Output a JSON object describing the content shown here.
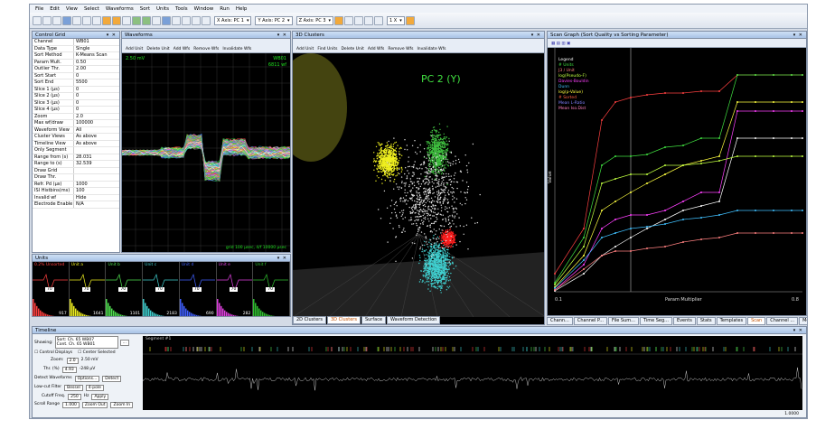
{
  "menu": [
    "File",
    "Edit",
    "View",
    "Select",
    "Waveforms",
    "Sort",
    "Units",
    "Tools",
    "Window",
    "Run",
    "Help"
  ],
  "toolbar": {
    "axis_x": "X Axis: PC 1",
    "axis_y": "Y Axis: PC 2",
    "axis_z": "Z Axis: PC 3",
    "zoom": "1 X"
  },
  "control_grid": {
    "title": "Control Grid",
    "rows": [
      [
        "Channel",
        "WB01"
      ],
      [
        "Data Type",
        "Single"
      ],
      [
        "Sort Method",
        "K-Means Scan"
      ],
      [
        "Param Mult.",
        "0.50"
      ],
      [
        "Outlier Thr.",
        "2.00"
      ],
      [
        "Sort Start",
        "0"
      ],
      [
        "Sort End",
        "5500"
      ],
      [
        "Slice 1 (µs)",
        "0"
      ],
      [
        "Slice 2 (µs)",
        "0"
      ],
      [
        "Slice 3 (µs)",
        "0"
      ],
      [
        "Slice 4 (µs)",
        "0"
      ],
      [
        "Zoom",
        "2.0"
      ],
      [
        "Max wf/draw",
        "100000"
      ],
      [
        "Waveform View",
        "All"
      ],
      [
        "Cluster Views",
        "As above"
      ],
      [
        "Timeline View",
        "As above"
      ],
      [
        "Only Segment",
        ""
      ],
      [
        "Range from (s)",
        "28.031"
      ],
      [
        "Range to (s)",
        "32.539"
      ],
      [
        "Draw Grid",
        ""
      ],
      [
        "Draw Thr.",
        ""
      ],
      [
        "Refr. Pd (µs)",
        "1000"
      ],
      [
        "ISI Histbins(ms)",
        "100"
      ],
      [
        "Invalid wf",
        "Hide"
      ],
      [
        "Electrode Enable",
        "N/A"
      ]
    ]
  },
  "waveforms": {
    "title": "Waveforms",
    "scale": "2.50 mV",
    "ch": "WB01",
    "count": "6811 wf",
    "footer": "grid 100 µsec, 4/f 10000 µsec",
    "toolbar": [
      "Add Unit",
      "Delete Unit",
      "Add Wfs",
      "Remove Wfs",
      "Invalidate Wfs"
    ]
  },
  "clusters": {
    "title": "3D Clusters",
    "axis_label": "PC 2 (Y)",
    "toolbar": [
      "Add Unit",
      "Find Units",
      "Delete Unit",
      "Add Wfs",
      "Remove Wfs",
      "Invalidate Wfs"
    ],
    "tabs": [
      "2D Clusters",
      "3D Clusters",
      "Surface",
      "Waveform Detection"
    ],
    "active_tab": "3D Clusters"
  },
  "scan": {
    "title": "Scan Graph (Sort Quality vs Sorting Parameter)",
    "legend": [
      "Legend",
      "# Units",
      "J3 / Unit",
      "log(Pseudo-F)",
      "Davies-Bouldin",
      "Dunn",
      "log(p-Value)",
      "# Sorted",
      "Mean L-Ratio",
      "Mean Iso.Dist"
    ],
    "xlabel": "Param Multiplier",
    "ylabel": "Value",
    "x_start": "0.1",
    "x_end": "0.8",
    "tabs": [
      "Chann...",
      "Channel P...",
      "File Sum...",
      "Time Seg...",
      "Events",
      "Stats",
      "Templates",
      "Scan",
      "Channel ...",
      "Messages"
    ],
    "active_tab": "Scan"
  },
  "units": {
    "title": "Units",
    "cells": [
      {
        "name": "0.2% Unsorted",
        "count": "917",
        "color": "#ff4040"
      },
      {
        "name": "Unit a",
        "count": "1641",
        "color": "#f0f020"
      },
      {
        "name": "Unit b",
        "count": "1101",
        "color": "#50e050"
      },
      {
        "name": "Unit c",
        "count": "2183",
        "color": "#40d0d0"
      },
      {
        "name": "Unit d",
        "count": "690",
        "color": "#4060ff"
      },
      {
        "name": "Unit e",
        "count": "282",
        "color": "#e040e0"
      },
      {
        "name": "Unit f",
        "count": "",
        "color": "#30c030"
      }
    ],
    "spin": "70"
  },
  "timeline": {
    "title": "Timeline",
    "showing_label": "Showing:",
    "sort_ch": "Sort: Ch. 65 WB07",
    "cont_ch": "Cont. Ch. 65 WB01",
    "control_displays": "Control Displays",
    "center_selected": "Center Selected",
    "zoom_label": "Zoom:",
    "zoom_value": "2.0",
    "zoom_mv": "2.50 mV",
    "thr_label": "Thr. (%)",
    "thr_value": "4.93",
    "thr_uv": "-248 µV",
    "detect_label": "Detect Waveforms",
    "options_btn": "Options...",
    "detect_btn": "Detect",
    "lowcut_label": "Low-cut Filter",
    "lowcut_value": "Bessel",
    "pole_value": "4-pole",
    "cutoff_label": "Cutoff Freq.",
    "cutoff_value": "250",
    "hz": "Hz",
    "apply_btn": "Apply",
    "scroll_label": "Scroll Range",
    "scroll_value": "1.000",
    "segment": "Segment #1",
    "zoom_out": "Zoom Out",
    "zoom_in": "Zoom In",
    "page": "1.0000"
  }
}
